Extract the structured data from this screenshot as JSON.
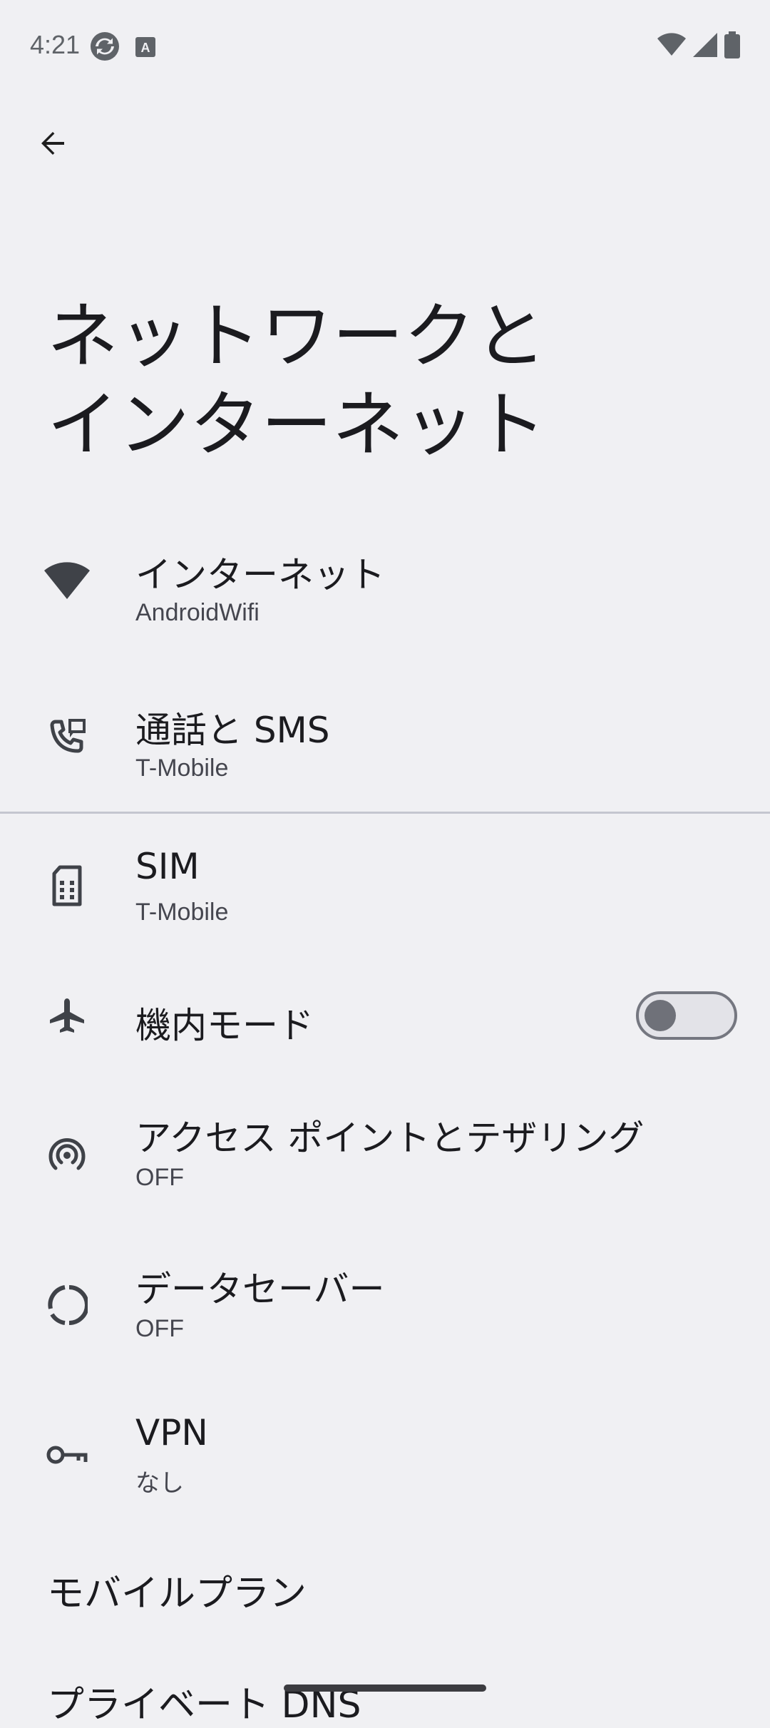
{
  "status_bar": {
    "time": "4:21",
    "left_icons": [
      "sync-icon",
      "keyboard-a-icon"
    ],
    "right_icons": [
      "wifi-icon",
      "cell-signal-icon",
      "battery-icon"
    ]
  },
  "header": {
    "back_icon": "arrow-back-icon",
    "title": "ネットワークと\nインターネット"
  },
  "items": [
    {
      "id": "internet",
      "icon": "wifi-icon",
      "title": "インターネット",
      "subtitle": "AndroidWifi"
    },
    {
      "id": "calls-sms",
      "icon": "phone-sms-icon",
      "title": "通話と SMS",
      "subtitle": "T-Mobile"
    },
    {
      "id": "sim",
      "icon": "sim-card-icon",
      "title": "SIM",
      "subtitle": "T-Mobile"
    },
    {
      "id": "airplane",
      "icon": "airplane-icon",
      "title": "機内モード",
      "toggle": false
    },
    {
      "id": "hotspot",
      "icon": "hotspot-icon",
      "title": "アクセス ポイントとテザリング",
      "subtitle": "OFF"
    },
    {
      "id": "data-saver",
      "icon": "data-saver-icon",
      "title": "データセーバー",
      "subtitle": "OFF"
    },
    {
      "id": "vpn",
      "icon": "vpn-key-icon",
      "title": "VPN",
      "subtitle": "なし"
    }
  ],
  "sections": {
    "mobile_plan": "モバイルプラン",
    "private_dns": "プライベート DNS"
  },
  "colors": {
    "background": "#f0f0f3",
    "icon": "#3f4248",
    "divider": "#c4c6cf",
    "toggle_off_knob": "#6f7179"
  }
}
